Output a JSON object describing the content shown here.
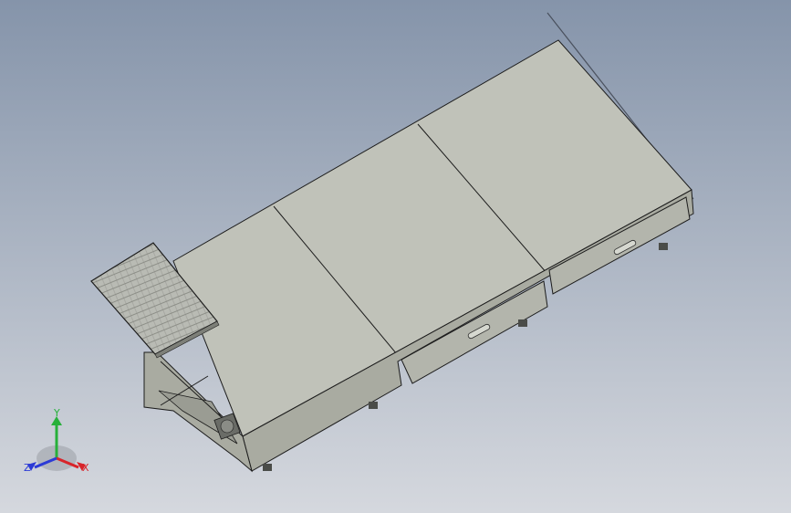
{
  "viewport": {
    "background_top": "#8896ab",
    "background_bottom": "#d3d7dd",
    "model_face_color": "#bfc1b8",
    "model_side_color": "#a7a99f",
    "edge_color": "#1c1c1c"
  },
  "triad": {
    "x_label": "X",
    "y_label": "Y",
    "z_label": "Z",
    "x_color": "#d8242a",
    "y_color": "#27b03a",
    "z_color": "#2c3bd6"
  }
}
